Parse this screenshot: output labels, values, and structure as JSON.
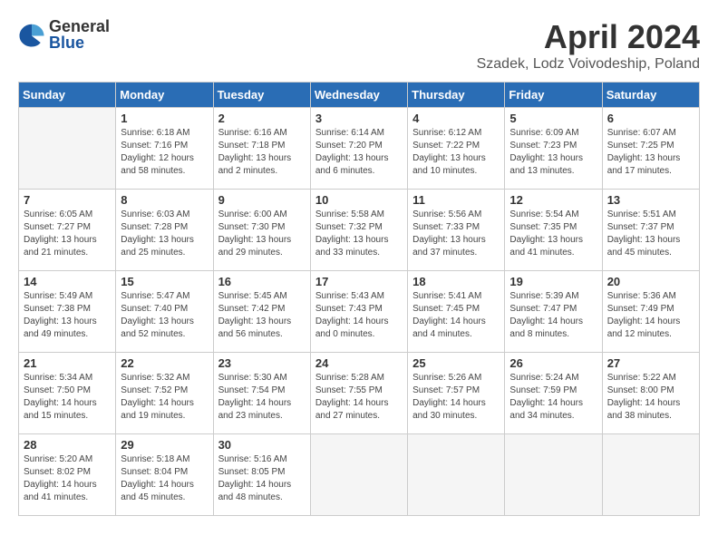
{
  "header": {
    "logo_general": "General",
    "logo_blue": "Blue",
    "month": "April 2024",
    "location": "Szadek, Lodz Voivodeship, Poland"
  },
  "days_of_week": [
    "Sunday",
    "Monday",
    "Tuesday",
    "Wednesday",
    "Thursday",
    "Friday",
    "Saturday"
  ],
  "weeks": [
    [
      {
        "day": "",
        "empty": true
      },
      {
        "day": "1",
        "sunrise": "Sunrise: 6:18 AM",
        "sunset": "Sunset: 7:16 PM",
        "daylight": "Daylight: 12 hours and 58 minutes."
      },
      {
        "day": "2",
        "sunrise": "Sunrise: 6:16 AM",
        "sunset": "Sunset: 7:18 PM",
        "daylight": "Daylight: 13 hours and 2 minutes."
      },
      {
        "day": "3",
        "sunrise": "Sunrise: 6:14 AM",
        "sunset": "Sunset: 7:20 PM",
        "daylight": "Daylight: 13 hours and 6 minutes."
      },
      {
        "day": "4",
        "sunrise": "Sunrise: 6:12 AM",
        "sunset": "Sunset: 7:22 PM",
        "daylight": "Daylight: 13 hours and 10 minutes."
      },
      {
        "day": "5",
        "sunrise": "Sunrise: 6:09 AM",
        "sunset": "Sunset: 7:23 PM",
        "daylight": "Daylight: 13 hours and 13 minutes."
      },
      {
        "day": "6",
        "sunrise": "Sunrise: 6:07 AM",
        "sunset": "Sunset: 7:25 PM",
        "daylight": "Daylight: 13 hours and 17 minutes."
      }
    ],
    [
      {
        "day": "7",
        "sunrise": "Sunrise: 6:05 AM",
        "sunset": "Sunset: 7:27 PM",
        "daylight": "Daylight: 13 hours and 21 minutes."
      },
      {
        "day": "8",
        "sunrise": "Sunrise: 6:03 AM",
        "sunset": "Sunset: 7:28 PM",
        "daylight": "Daylight: 13 hours and 25 minutes."
      },
      {
        "day": "9",
        "sunrise": "Sunrise: 6:00 AM",
        "sunset": "Sunset: 7:30 PM",
        "daylight": "Daylight: 13 hours and 29 minutes."
      },
      {
        "day": "10",
        "sunrise": "Sunrise: 5:58 AM",
        "sunset": "Sunset: 7:32 PM",
        "daylight": "Daylight: 13 hours and 33 minutes."
      },
      {
        "day": "11",
        "sunrise": "Sunrise: 5:56 AM",
        "sunset": "Sunset: 7:33 PM",
        "daylight": "Daylight: 13 hours and 37 minutes."
      },
      {
        "day": "12",
        "sunrise": "Sunrise: 5:54 AM",
        "sunset": "Sunset: 7:35 PM",
        "daylight": "Daylight: 13 hours and 41 minutes."
      },
      {
        "day": "13",
        "sunrise": "Sunrise: 5:51 AM",
        "sunset": "Sunset: 7:37 PM",
        "daylight": "Daylight: 13 hours and 45 minutes."
      }
    ],
    [
      {
        "day": "14",
        "sunrise": "Sunrise: 5:49 AM",
        "sunset": "Sunset: 7:38 PM",
        "daylight": "Daylight: 13 hours and 49 minutes."
      },
      {
        "day": "15",
        "sunrise": "Sunrise: 5:47 AM",
        "sunset": "Sunset: 7:40 PM",
        "daylight": "Daylight: 13 hours and 52 minutes."
      },
      {
        "day": "16",
        "sunrise": "Sunrise: 5:45 AM",
        "sunset": "Sunset: 7:42 PM",
        "daylight": "Daylight: 13 hours and 56 minutes."
      },
      {
        "day": "17",
        "sunrise": "Sunrise: 5:43 AM",
        "sunset": "Sunset: 7:43 PM",
        "daylight": "Daylight: 14 hours and 0 minutes."
      },
      {
        "day": "18",
        "sunrise": "Sunrise: 5:41 AM",
        "sunset": "Sunset: 7:45 PM",
        "daylight": "Daylight: 14 hours and 4 minutes."
      },
      {
        "day": "19",
        "sunrise": "Sunrise: 5:39 AM",
        "sunset": "Sunset: 7:47 PM",
        "daylight": "Daylight: 14 hours and 8 minutes."
      },
      {
        "day": "20",
        "sunrise": "Sunrise: 5:36 AM",
        "sunset": "Sunset: 7:49 PM",
        "daylight": "Daylight: 14 hours and 12 minutes."
      }
    ],
    [
      {
        "day": "21",
        "sunrise": "Sunrise: 5:34 AM",
        "sunset": "Sunset: 7:50 PM",
        "daylight": "Daylight: 14 hours and 15 minutes."
      },
      {
        "day": "22",
        "sunrise": "Sunrise: 5:32 AM",
        "sunset": "Sunset: 7:52 PM",
        "daylight": "Daylight: 14 hours and 19 minutes."
      },
      {
        "day": "23",
        "sunrise": "Sunrise: 5:30 AM",
        "sunset": "Sunset: 7:54 PM",
        "daylight": "Daylight: 14 hours and 23 minutes."
      },
      {
        "day": "24",
        "sunrise": "Sunrise: 5:28 AM",
        "sunset": "Sunset: 7:55 PM",
        "daylight": "Daylight: 14 hours and 27 minutes."
      },
      {
        "day": "25",
        "sunrise": "Sunrise: 5:26 AM",
        "sunset": "Sunset: 7:57 PM",
        "daylight": "Daylight: 14 hours and 30 minutes."
      },
      {
        "day": "26",
        "sunrise": "Sunrise: 5:24 AM",
        "sunset": "Sunset: 7:59 PM",
        "daylight": "Daylight: 14 hours and 34 minutes."
      },
      {
        "day": "27",
        "sunrise": "Sunrise: 5:22 AM",
        "sunset": "Sunset: 8:00 PM",
        "daylight": "Daylight: 14 hours and 38 minutes."
      }
    ],
    [
      {
        "day": "28",
        "sunrise": "Sunrise: 5:20 AM",
        "sunset": "Sunset: 8:02 PM",
        "daylight": "Daylight: 14 hours and 41 minutes."
      },
      {
        "day": "29",
        "sunrise": "Sunrise: 5:18 AM",
        "sunset": "Sunset: 8:04 PM",
        "daylight": "Daylight: 14 hours and 45 minutes."
      },
      {
        "day": "30",
        "sunrise": "Sunrise: 5:16 AM",
        "sunset": "Sunset: 8:05 PM",
        "daylight": "Daylight: 14 hours and 48 minutes."
      },
      {
        "day": "",
        "empty": true
      },
      {
        "day": "",
        "empty": true
      },
      {
        "day": "",
        "empty": true
      },
      {
        "day": "",
        "empty": true
      }
    ]
  ]
}
